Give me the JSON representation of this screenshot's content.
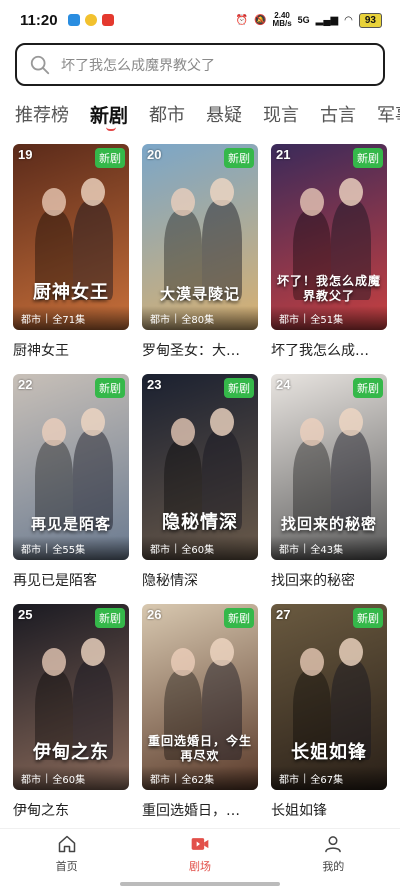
{
  "status": {
    "time": "11:20",
    "net_speed_value": "2.40",
    "net_speed_unit": "MB/s",
    "network": "5G",
    "battery": "93"
  },
  "search": {
    "placeholder": "坏了我怎么成魔界教父了"
  },
  "tabs": [
    {
      "label": "推荐榜"
    },
    {
      "label": "新剧",
      "active": true
    },
    {
      "label": "都市"
    },
    {
      "label": "悬疑"
    },
    {
      "label": "现言"
    },
    {
      "label": "古言"
    },
    {
      "label": "军事"
    }
  ],
  "cards": [
    {
      "rank": "19",
      "badge": "新剧",
      "poster_text": "厨神女王",
      "genre": "都市",
      "episodes": "全71集",
      "title": "厨神女王",
      "palette": [
        "#5a2a1a",
        "#c8703a"
      ]
    },
    {
      "rank": "20",
      "badge": "新剧",
      "poster_text": "大漠寻陵记",
      "genre": "都市",
      "episodes": "全80集",
      "title": "罗甸圣女：大…",
      "palette": [
        "#7ba6c8",
        "#d8b070"
      ]
    },
    {
      "rank": "21",
      "badge": "新剧",
      "poster_text": "坏了！我怎么成魔界教父了",
      "genre": "都市",
      "episodes": "全51集",
      "title": "坏了我怎么成…",
      "palette": [
        "#3a2a5a",
        "#c84040"
      ]
    },
    {
      "rank": "22",
      "badge": "新剧",
      "poster_text": "再见是陌客",
      "genre": "都市",
      "episodes": "全55集",
      "title": "再见已是陌客",
      "palette": [
        "#c8c0b8",
        "#6a7a90"
      ]
    },
    {
      "rank": "23",
      "badge": "新剧",
      "poster_text": "隐秘情深",
      "genre": "都市",
      "episodes": "全60集",
      "title": "隐秘情深",
      "palette": [
        "#1a2030",
        "#6a5a4a"
      ]
    },
    {
      "rank": "24",
      "badge": "新剧",
      "poster_text": "找回来的秘密",
      "genre": "都市",
      "episodes": "全43集",
      "title": "找回来的秘密",
      "palette": [
        "#e8e4e0",
        "#5a5a5a"
      ]
    },
    {
      "rank": "25",
      "badge": "新剧",
      "poster_text": "伊甸之东",
      "genre": "都市",
      "episodes": "全60集",
      "title": "伊甸之东",
      "palette": [
        "#1a1a22",
        "#8a6a5a"
      ]
    },
    {
      "rank": "26",
      "badge": "新剧",
      "poster_text": "重回选婚日，今生再尽欢",
      "genre": "都市",
      "episodes": "全62集",
      "title": "重回选婚日，…",
      "palette": [
        "#d8c8b0",
        "#5a3a2a"
      ]
    },
    {
      "rank": "27",
      "badge": "新剧",
      "poster_text": "长姐如锋",
      "genre": "都市",
      "episodes": "全67集",
      "title": "长姐如锋",
      "palette": [
        "#6a5a40",
        "#2a2018"
      ]
    }
  ],
  "nav": [
    {
      "label": "首页",
      "icon": "home-icon"
    },
    {
      "label": "剧场",
      "icon": "theater-icon",
      "active": true
    },
    {
      "label": "我的",
      "icon": "profile-icon"
    }
  ],
  "colors": {
    "accent": "#e2504a",
    "badge_green": "#35b84a"
  }
}
